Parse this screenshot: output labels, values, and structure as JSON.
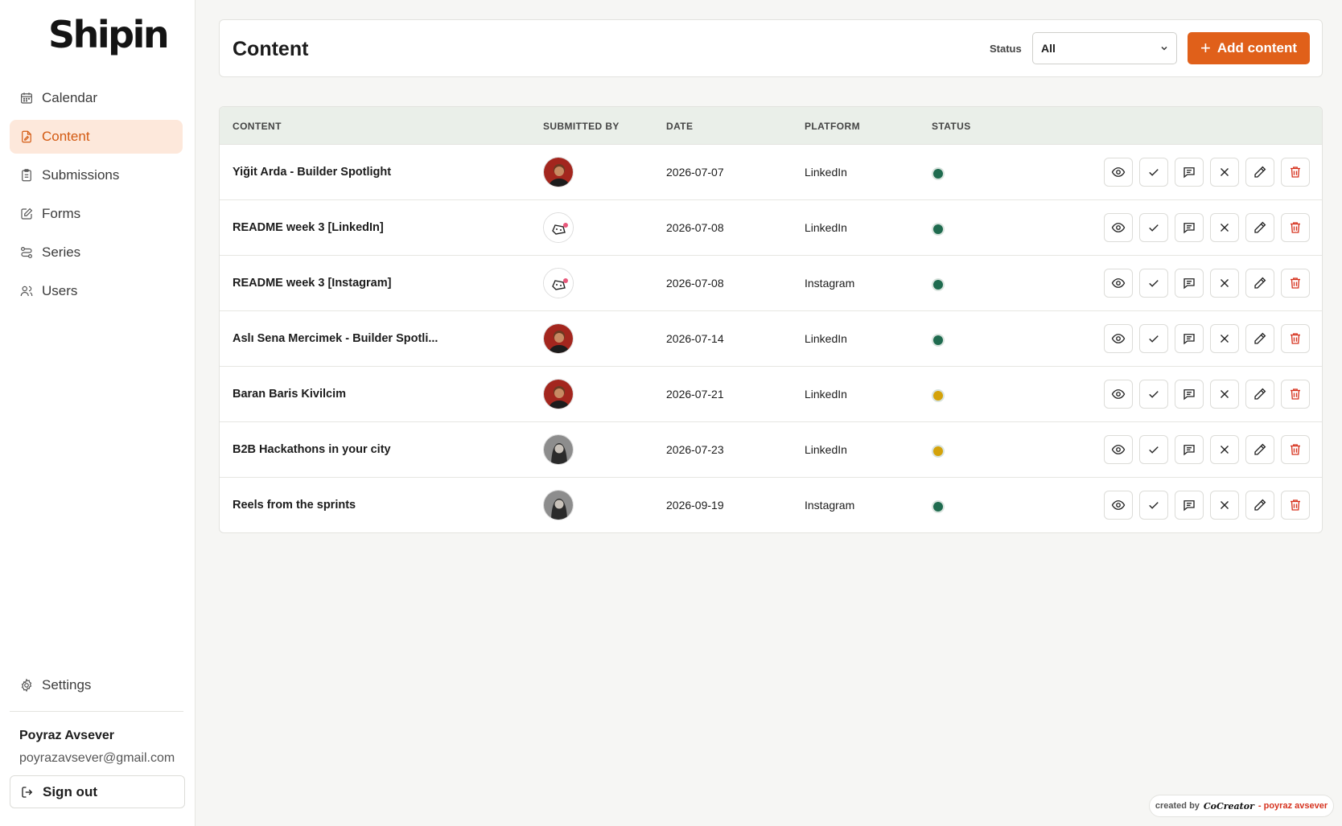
{
  "app": {
    "logo": "Shipin"
  },
  "sidebar": {
    "items": [
      {
        "label": "Calendar",
        "icon": "calendar-icon",
        "active": false
      },
      {
        "label": "Content",
        "icon": "file-edit-icon",
        "active": true
      },
      {
        "label": "Submissions",
        "icon": "clipboard-icon",
        "active": false
      },
      {
        "label": "Forms",
        "icon": "form-edit-icon",
        "active": false
      },
      {
        "label": "Series",
        "icon": "series-icon",
        "active": false
      },
      {
        "label": "Users",
        "icon": "users-icon",
        "active": false
      }
    ],
    "settings_label": "Settings",
    "user": {
      "name": "Poyraz Avsever",
      "email": "poyrazavsever@gmail.com"
    },
    "signout_label": "Sign out"
  },
  "header": {
    "title": "Content",
    "status_label": "Status",
    "status_value": "All",
    "add_button": "Add content"
  },
  "table": {
    "columns": [
      "CONTENT",
      "SUBMITTED BY",
      "DATE",
      "PLATFORM",
      "STATUS"
    ],
    "rows": [
      {
        "title": "Yiğit Arda - Builder Spotlight",
        "avatar": "man-red",
        "date": "2026-07-07",
        "platform": "LinkedIn",
        "status_color": "#1f6b4f"
      },
      {
        "title": "README week 3 [LinkedIn]",
        "avatar": "logo-heart",
        "date": "2026-07-08",
        "platform": "LinkedIn",
        "status_color": "#1f6b4f"
      },
      {
        "title": "README week 3 [Instagram]",
        "avatar": "logo-heart",
        "date": "2026-07-08",
        "platform": "Instagram",
        "status_color": "#1f6b4f"
      },
      {
        "title": "Aslı Sena Mercimek - Builder Spotli...",
        "avatar": "man-red",
        "date": "2026-07-14",
        "platform": "LinkedIn",
        "status_color": "#1f6b4f"
      },
      {
        "title": "Baran Baris Kivilcim",
        "avatar": "man-red",
        "date": "2026-07-21",
        "platform": "LinkedIn",
        "status_color": "#d4a20a"
      },
      {
        "title": "B2B Hackathons in your city",
        "avatar": "woman-gray",
        "date": "2026-07-23",
        "platform": "LinkedIn",
        "status_color": "#d4a20a"
      },
      {
        "title": "Reels from the sprints",
        "avatar": "woman-gray",
        "date": "2026-09-19",
        "platform": "Instagram",
        "status_color": "#1f6b4f"
      }
    ],
    "actions": [
      "view-icon",
      "approve-icon",
      "comment-icon",
      "reject-icon",
      "edit-icon",
      "delete-icon"
    ]
  },
  "credit": {
    "prefix": "created by",
    "brand": "CoCreator",
    "author": "- poyraz avsever"
  },
  "colors": {
    "accent": "#e0601a",
    "active_bg": "#fde8db",
    "approved": "#1f6b4f",
    "pending": "#d4a20a",
    "danger": "#d6331f"
  }
}
